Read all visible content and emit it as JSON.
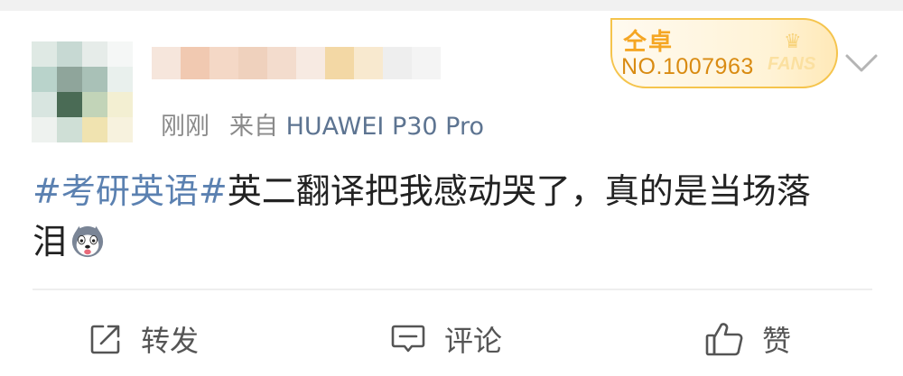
{
  "post": {
    "time": "刚刚",
    "source_prefix": "来自",
    "device": "HUAWEI P30 Pro",
    "content_hashtag": "#考研英语#",
    "content_text_line1": "英二翻译把我感动哭了，真的是当场落",
    "content_text_line2": "泪"
  },
  "badge": {
    "title": "仝卓",
    "number": "NO.1007963",
    "fans_label": "FANS"
  },
  "actions": {
    "repost": "转发",
    "comment": "评论",
    "like": "赞"
  },
  "colors": {
    "hashtag": "#5b81b1",
    "device": "#5d7491",
    "badge_accent": "#f5a623"
  }
}
